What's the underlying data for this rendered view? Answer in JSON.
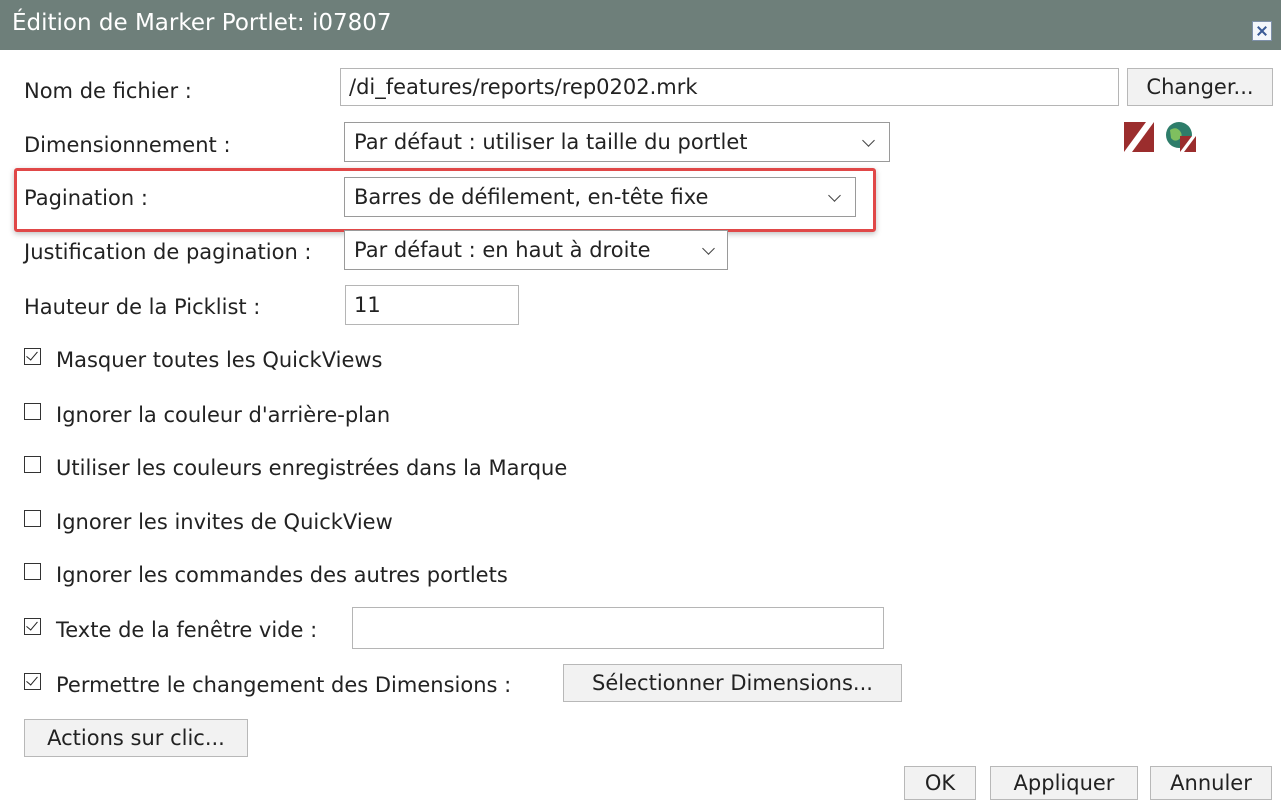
{
  "dialog": {
    "title": "Édition de Marker Portlet: i07807"
  },
  "fields": {
    "filename": {
      "label": "Nom de fichier :",
      "value": "/di_features/reports/rep0202.mrk",
      "change_label": "Changer..."
    },
    "sizing": {
      "label": "Dimensionnement :",
      "value": "Par défaut : utiliser la taille du portlet"
    },
    "pagination": {
      "label": "Pagination :",
      "value": "Barres de défilement, en-tête fixe"
    },
    "pagination_justification": {
      "label": "Justification de pagination :",
      "value": "Par défaut : en haut à droite"
    },
    "picklist_height": {
      "label": "Hauteur de la Picklist :",
      "value": "11"
    }
  },
  "checkboxes": [
    {
      "label": "Masquer toutes les QuickViews",
      "checked": true
    },
    {
      "label": "Ignorer la couleur d'arrière-plan",
      "checked": false
    },
    {
      "label": "Utiliser les couleurs enregistrées dans la Marque",
      "checked": false
    },
    {
      "label": "Ignorer les invites de QuickView",
      "checked": false
    },
    {
      "label": "Ignorer les commandes des autres portlets",
      "checked": false
    },
    {
      "label": "Texte de la fenêtre vide :",
      "checked": true,
      "value": ""
    },
    {
      "label": "Permettre le changement des Dimensions :",
      "checked": true
    }
  ],
  "buttons": {
    "select_dimensions": "Sélectionner Dimensions...",
    "click_actions": "Actions sur clic...",
    "ok": "OK",
    "apply": "Appliquer",
    "cancel": "Annuler"
  },
  "icons": [
    "edit-marker-icon",
    "globe-icon",
    "close-icon",
    "chevron-down-icon"
  ],
  "colors": {
    "titlebar": "#6e7f7a",
    "highlight": "#e04848"
  }
}
